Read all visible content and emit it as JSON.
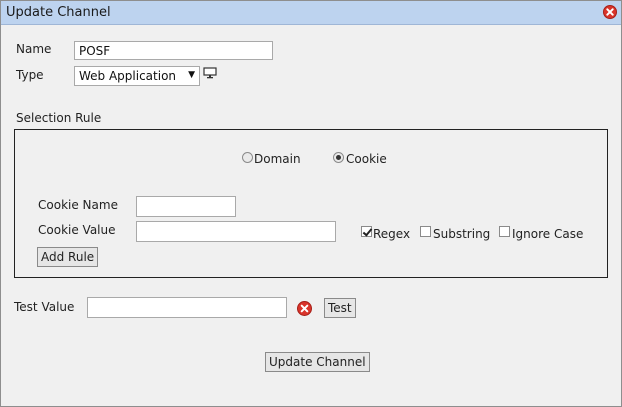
{
  "dialog": {
    "title": "Update Channel",
    "close_icon": "close-x-red-circle-icon"
  },
  "form": {
    "name_label": "Name",
    "name_value": "POSF",
    "type_label": "Type",
    "type_value": "Web Application",
    "type_icon": "monitor-icon"
  },
  "selection_rule": {
    "label": "Selection Rule",
    "radio_domain": "Domain",
    "radio_cookie": "Cookie",
    "selected": "Cookie",
    "cookie_name_label": "Cookie Name",
    "cookie_name_value": "",
    "cookie_value_label": "Cookie Value",
    "cookie_value_value": "",
    "regex_label": "Regex",
    "regex_checked": true,
    "substring_label": "Substring",
    "substring_checked": false,
    "ignore_case_label": "Ignore Case",
    "ignore_case_checked": false,
    "add_rule_button": "Add Rule"
  },
  "test": {
    "label": "Test Value",
    "value": "",
    "clear_icon": "clear-x-red-circle-icon",
    "test_button": "Test"
  },
  "footer": {
    "update_button": "Update Channel"
  },
  "colors": {
    "titlebar": "#bdd3ef",
    "dialog_bg": "#f0f0f0",
    "close_red": "#d9342b"
  }
}
